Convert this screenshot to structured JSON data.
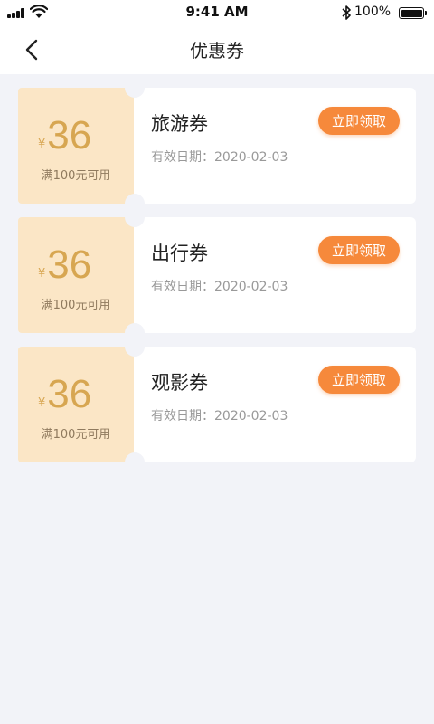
{
  "status_bar": {
    "time": "9:41 AM",
    "battery_percent": "100%",
    "icons": [
      "signal-icon",
      "wifi-icon",
      "bluetooth-icon",
      "battery-icon"
    ]
  },
  "nav": {
    "title": "优惠券",
    "back_icon": "chevron-left-icon"
  },
  "coupons": [
    {
      "currency": "¥",
      "amount": "36",
      "condition": "满100元可用",
      "name": "旅游券",
      "valid": "有效日期：2020-02-03",
      "claim_label": "立即领取"
    },
    {
      "currency": "¥",
      "amount": "36",
      "condition": "满100元可用",
      "name": "出行券",
      "valid": "有效日期：2020-02-03",
      "claim_label": "立即领取"
    },
    {
      "currency": "¥",
      "amount": "36",
      "condition": "满100元可用",
      "name": "观影券",
      "valid": "有效日期：2020-02-03",
      "claim_label": "立即领取"
    }
  ],
  "colors": {
    "accent": "#f6893b",
    "coupon_left_bg": "#fbe6c6",
    "amount": "#d7a651",
    "page_bg": "#f2f3f8"
  }
}
